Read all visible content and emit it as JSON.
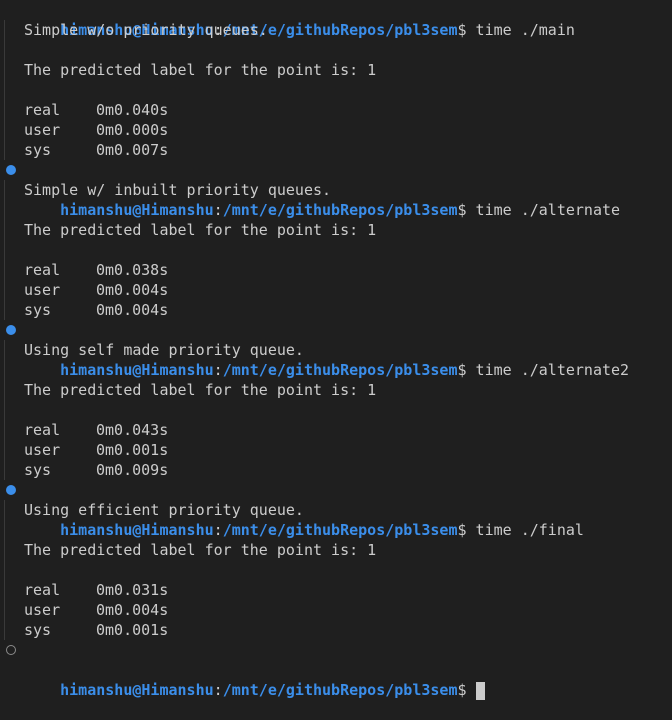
{
  "prompt": {
    "user": "himanshu@Himanshu",
    "sep": ":",
    "path": "/mnt/e/githubRepos/pbl3sem",
    "symbol": "$"
  },
  "colors": {
    "background": "#1f1f1f",
    "prompt_blue": "#3b8eea",
    "text": "#cccccc"
  },
  "runs": [
    {
      "command": " time ./main",
      "message": "Simple w/o priority queues.",
      "result": "The predicted label for the point is: 1",
      "times": [
        {
          "label": "real",
          "value": "0m0.040s"
        },
        {
          "label": "user",
          "value": "0m0.000s"
        },
        {
          "label": "sys",
          "value": "0m0.007s"
        }
      ]
    },
    {
      "command": " time ./alternate",
      "message": "Simple w/ inbuilt priority queues.",
      "result": "The predicted label for the point is: 1",
      "times": [
        {
          "label": "real",
          "value": "0m0.038s"
        },
        {
          "label": "user",
          "value": "0m0.004s"
        },
        {
          "label": "sys",
          "value": "0m0.004s"
        }
      ]
    },
    {
      "command": " time ./alternate2",
      "message": "Using self made priority queue.",
      "result": "The predicted label for the point is: 1",
      "times": [
        {
          "label": "real",
          "value": "0m0.043s"
        },
        {
          "label": "user",
          "value": "0m0.001s"
        },
        {
          "label": "sys",
          "value": "0m0.009s"
        }
      ]
    },
    {
      "command": " time ./final",
      "message": "Using efficient priority queue.",
      "result": "The predicted label for the point is: 1",
      "times": [
        {
          "label": "real",
          "value": "0m0.031s"
        },
        {
          "label": "user",
          "value": "0m0.004s"
        },
        {
          "label": "sys",
          "value": "0m0.001s"
        }
      ]
    }
  ]
}
